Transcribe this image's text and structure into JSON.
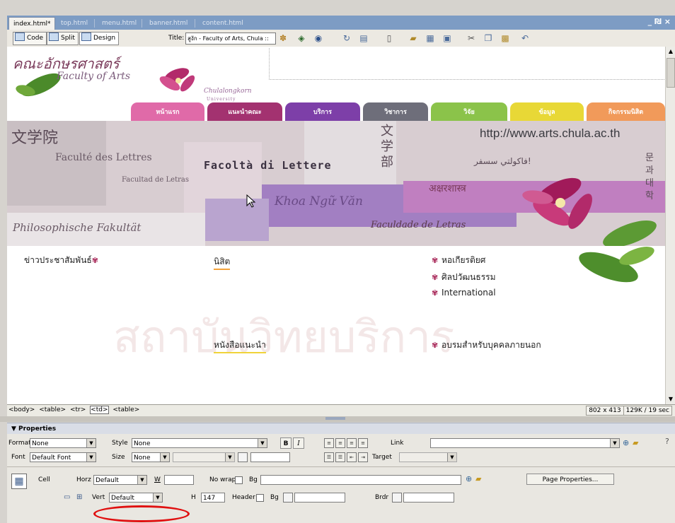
{
  "document_tabs": [
    {
      "label": "index.html*",
      "active": true
    },
    {
      "label": "top.html",
      "active": false
    },
    {
      "label": "menu.html",
      "active": false
    },
    {
      "label": "banner.html",
      "active": false
    },
    {
      "label": "content.html",
      "active": false
    }
  ],
  "window_controls": "_ ₪ ×",
  "toolbar": {
    "code_label": "Code",
    "split_label": "Split",
    "design_label": "Design",
    "title_label": "Title:",
    "title_value": "สูงัก - Faculty of Arts, Chula ::"
  },
  "canvas": {
    "logo_thai": "คณะอักษรศาสตร์",
    "logo_english": "Faculty of Arts",
    "logo_chula": "Chulalongkorn",
    "logo_university": "University",
    "nav_tabs": [
      {
        "label": "หน้าแรก",
        "color": "#e06aa8"
      },
      {
        "label": "แนะนำคณะ",
        "color": "#a33270"
      },
      {
        "label": "บริการ",
        "color": "#7d3fa8"
      },
      {
        "label": "วิชาการ",
        "color": "#6e6e7a"
      },
      {
        "label": "วิจัย",
        "color": "#8bc34a"
      },
      {
        "label": "ข้อมูล",
        "color": "#e8d836"
      },
      {
        "label": "กิจกรรมนิสิต",
        "color": "#f19a5a"
      }
    ],
    "banner": {
      "kanji_left": "文学院",
      "french": "Faculté des Lettres",
      "italian": "Facoltà di Lettere",
      "spanish": "Facultad de Letras",
      "vietnamese": "Khoa Ngữ Văn",
      "german": "Philosophische Fakultät",
      "japanese": "文学部",
      "url": "http://www.arts.chula.ac.th",
      "arabic": "فاكولتي سسفر!",
      "hindi": "अक्षरशास्त्र",
      "korean": "문과대학",
      "portuguese": "Faculdade de Letras"
    },
    "links_left": [
      {
        "label": "ข่าวประชาสัมพันธ์",
        "star": true
      }
    ],
    "links_mid": [
      {
        "label": "นิสิต"
      },
      {
        "label": "หนังสือแนะนำ"
      }
    ],
    "links_right": [
      {
        "label": "หอเกียรติยศ"
      },
      {
        "label": "ศิลปวัฒนธรรม"
      },
      {
        "label": "International"
      },
      {
        "label": "อบรมสำหรับบุคคลภายนอก"
      }
    ],
    "watermark": "สถาบันวิทยบริการ"
  },
  "statusbar": {
    "tags": [
      "<body>",
      "<table>",
      "<tr>",
      "<td>",
      "<table>"
    ],
    "dimensions": "802 x 413 ⌄",
    "size_time": "129K / 19 sec"
  },
  "properties": {
    "header": "▼ Properties",
    "format_label": "Format",
    "format_value": "None",
    "style_label": "Style",
    "style_value": "None",
    "bold": "B",
    "italic": "I",
    "link_label": "Link",
    "font_label": "Font",
    "font_value": "Default Font",
    "size_label": "Size",
    "size_value": "None",
    "target_label": "Target",
    "cell_label": "Cell",
    "horz_label": "Horz",
    "horz_value": "Default",
    "w_label": "W",
    "nowrap_label": "No wrap",
    "bg_label": "Bg",
    "page_properties": "Page Properties...",
    "vert_label": "Vert",
    "vert_value": "Default",
    "h_label": "H",
    "h_value": "147",
    "header_label": "Header",
    "bg2_label": "Bg",
    "brdr_label": "Brdr"
  },
  "colors": {
    "tabs_bg": "#7d9cc4",
    "panel_bg": "#e9e7e1",
    "highlight_ellipse": "#e01010"
  }
}
